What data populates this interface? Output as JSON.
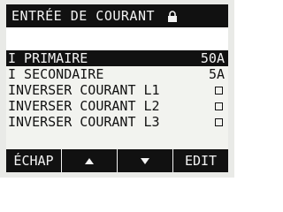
{
  "screen": {
    "title": "ENTRÉE DE COURANT",
    "title_icon": "lock-icon"
  },
  "items": [
    {
      "label": "I PRIMAIRE",
      "value": "50A",
      "selected": true
    },
    {
      "label": "I SECONDAIRE",
      "value": "5A",
      "selected": false
    },
    {
      "label": "INVERSER COURANT L1",
      "control": "checkbox",
      "checked": false,
      "selected": false
    },
    {
      "label": "INVERSER COURANT L2",
      "control": "checkbox",
      "checked": false,
      "selected": false
    },
    {
      "label": "INVERSER COURANT L3",
      "control": "checkbox",
      "checked": false,
      "selected": false
    }
  ],
  "softkeys": {
    "escape_label": "ÉCHAP",
    "up_icon": "arrow-up-icon",
    "down_icon": "arrow-down-icon",
    "edit_label": "EDIT"
  },
  "colors": {
    "lcd_background": "#f2f3ef",
    "lcd_foreground": "#111111",
    "highlight_text": "#f3f3f3"
  }
}
